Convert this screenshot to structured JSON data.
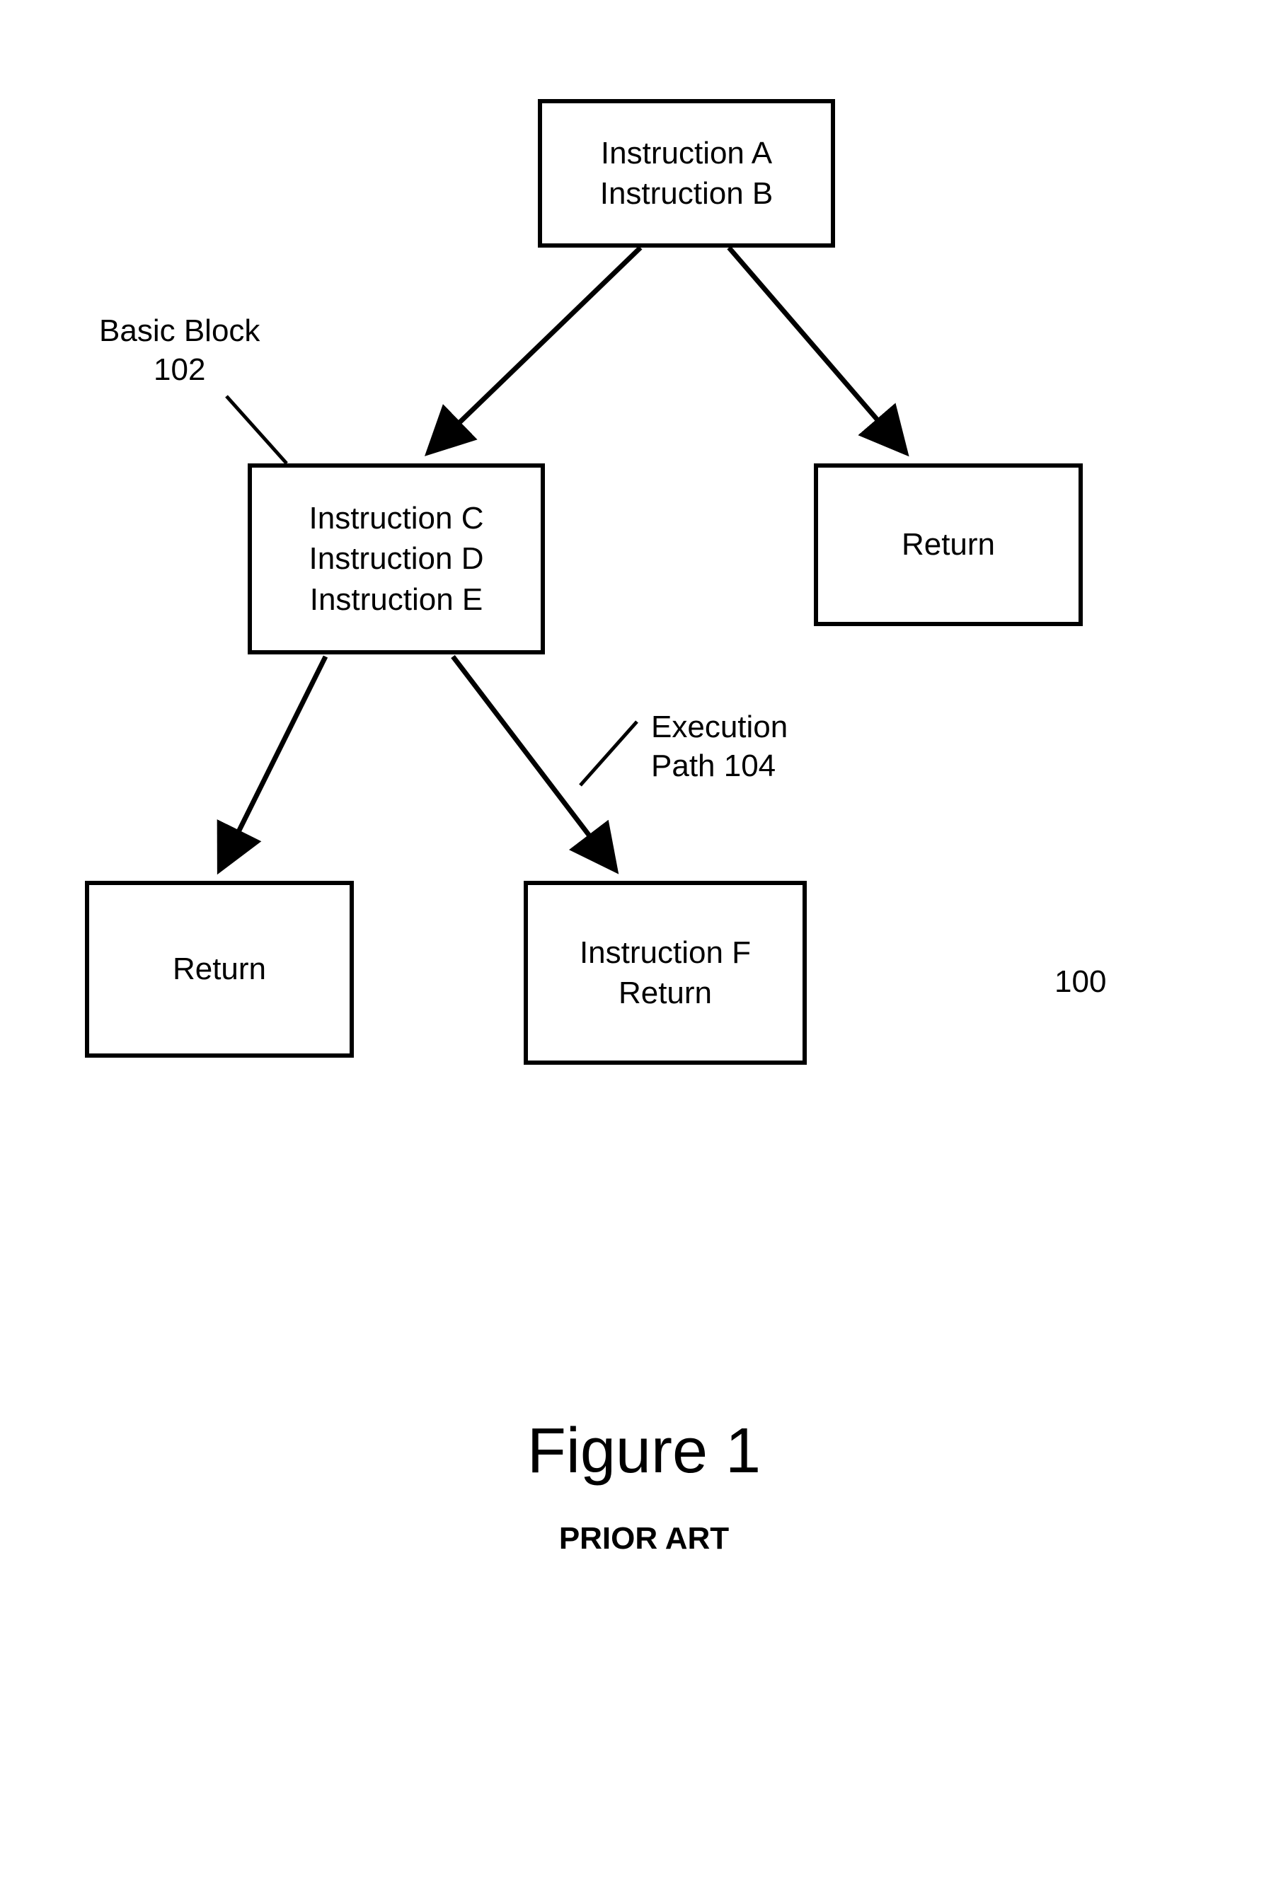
{
  "nodes": {
    "top": {
      "lines": [
        "Instruction A",
        "Instruction B"
      ]
    },
    "left_mid": {
      "lines": [
        "Instruction C",
        "Instruction D",
        "Instruction E"
      ]
    },
    "right_mid": {
      "lines": [
        "Return"
      ]
    },
    "bottom_left": {
      "lines": [
        "Return"
      ]
    },
    "bottom_right": {
      "lines": [
        "Instruction F",
        "Return"
      ]
    }
  },
  "labels": {
    "basic_block": {
      "line1": "Basic Block",
      "line2": "102"
    },
    "execution_path": {
      "line1": "Execution",
      "line2": "Path 104"
    },
    "figure_number": "100"
  },
  "figure": {
    "title": "Figure 1",
    "subtitle": "PRIOR ART"
  }
}
